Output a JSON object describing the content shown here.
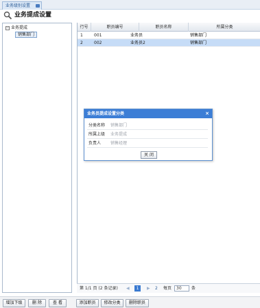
{
  "tabs": [
    {
      "label": "业务级别设置"
    }
  ],
  "page": {
    "title": "业务提成设置"
  },
  "tree": {
    "root": {
      "label": "业务提成",
      "expanded": true
    },
    "children": [
      {
        "label": "销售部门",
        "selected": true
      }
    ]
  },
  "grid": {
    "columns": [
      "行号",
      "职员编号",
      "职员名称",
      "所属分类"
    ],
    "rows": [
      {
        "no": "1",
        "code": "001",
        "name": "业务员",
        "category": "销售部门",
        "selected": false
      },
      {
        "no": "2",
        "code": "002",
        "name": "业务员2",
        "category": "销售部门",
        "selected": true
      }
    ]
  },
  "pager": {
    "info": "第 1/1 页 (2 条记录)",
    "current_page": "1",
    "next_page": "2",
    "per_page_label": "每页",
    "per_page_value": "30",
    "unit": "条"
  },
  "bottom_buttons": {
    "add_sub": "增加下级",
    "delete": "删 除",
    "view": "查 看",
    "add_employee": "添加职员",
    "edit_category": "修改分类",
    "delete_employee": "删除职员"
  },
  "dialog": {
    "title": "业务员提成设置分类",
    "close": "×",
    "fields": [
      {
        "label": "分类名称",
        "value": "销售部门"
      },
      {
        "label": "所属上级",
        "value": "业务提成"
      },
      {
        "label": "负责人",
        "value": "销售经理"
      }
    ],
    "close_button": "关 闭"
  },
  "colors": {
    "accent": "#3c7ed6",
    "selected_row": "#c6dcf7",
    "border": "#a9b9cc"
  }
}
